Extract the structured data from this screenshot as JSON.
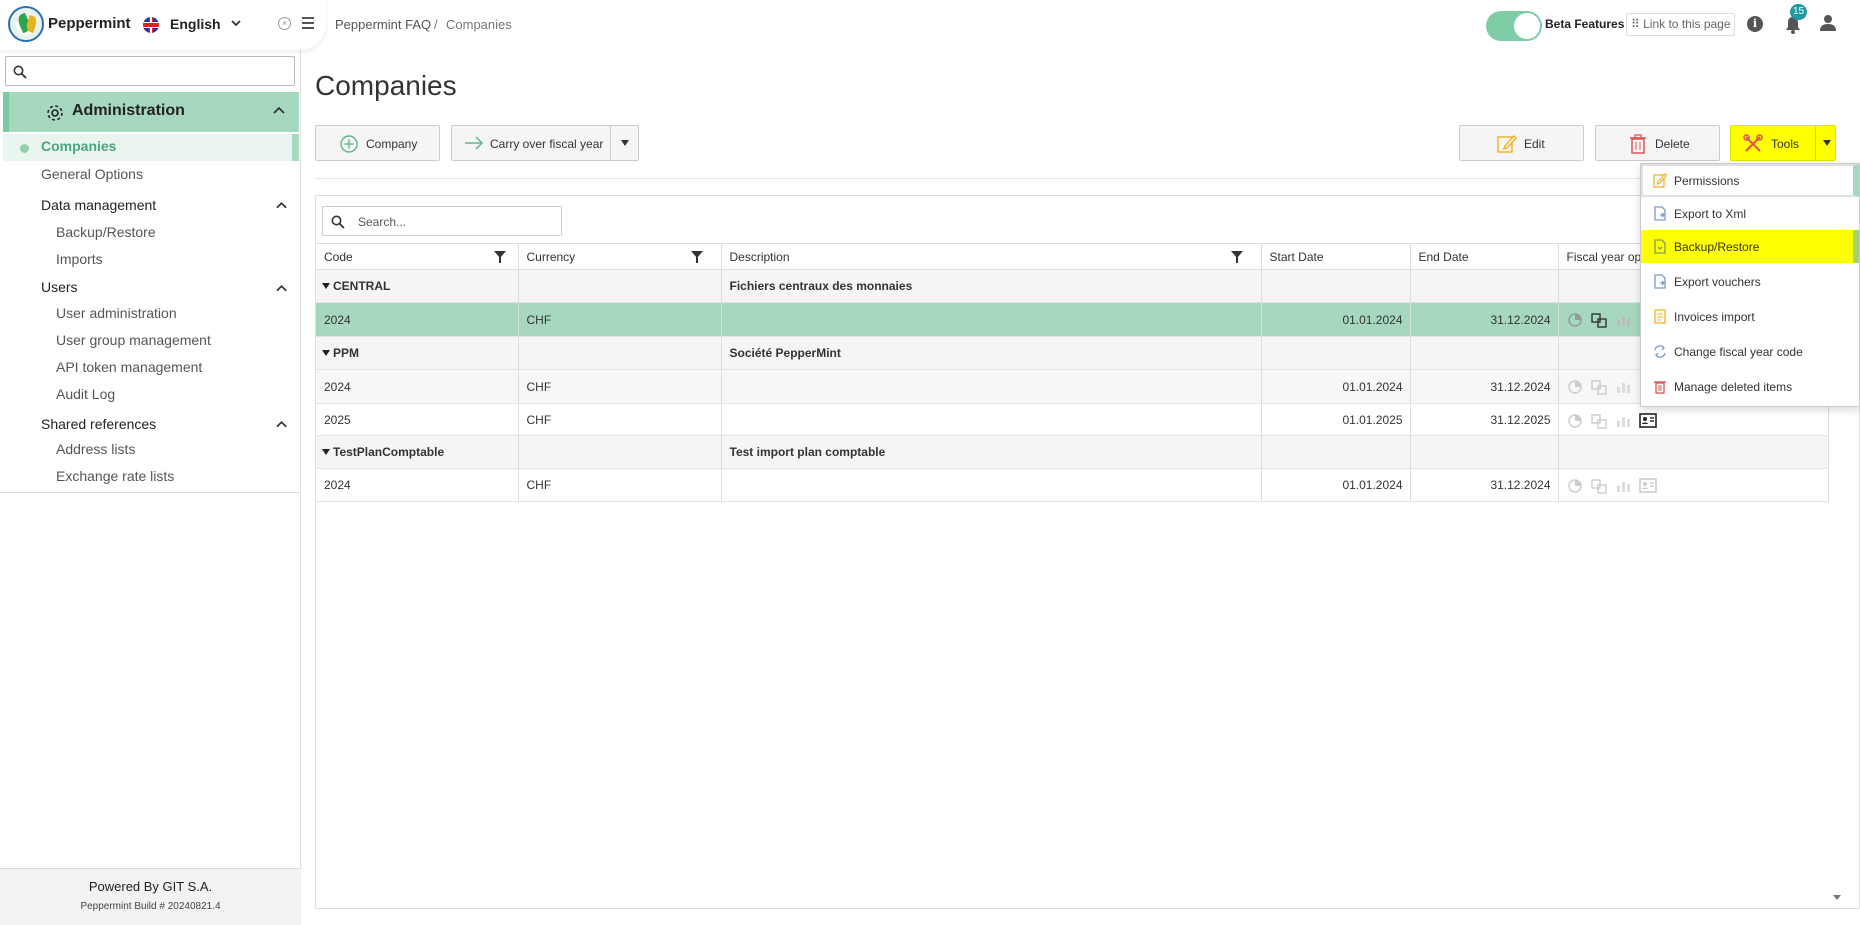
{
  "app": {
    "name": "Peppermint",
    "language": "English"
  },
  "breadcrumb": {
    "root": "Peppermint FAQ",
    "separator": "/",
    "current": "Companies"
  },
  "topbar": {
    "beta_label": "Beta Features",
    "link_label": "⠿ Link to this page",
    "notification_count": "15",
    "info_glyph": "i"
  },
  "sidebar": {
    "section": "Administration",
    "active_item": "Companies",
    "items": [
      {
        "label": "General Options"
      }
    ],
    "groups": [
      {
        "label": "Data management",
        "items": [
          "Backup/Restore",
          "Imports"
        ]
      },
      {
        "label": "Users",
        "items": [
          "User administration",
          "User group management",
          "API token management",
          "Audit Log"
        ]
      },
      {
        "label": "Shared references",
        "items": [
          "Address lists",
          "Exchange rate lists"
        ]
      }
    ],
    "footer": {
      "powered": "Powered By GIT S.A.",
      "build": "Peppermint Build # 20240821.4"
    }
  },
  "main": {
    "title": "Companies",
    "buttons": {
      "company": "Company",
      "carry_over": "Carry over fiscal year",
      "edit": "Edit",
      "delete": "Delete",
      "tools": "Tools"
    },
    "search_placeholder": "Search...",
    "columns": [
      "Code",
      "Currency",
      "Description",
      "Start Date",
      "End Date",
      "Fiscal year op"
    ],
    "groups": [
      {
        "code": "CENTRAL",
        "description": "Fichiers centraux des monnaies",
        "rows": [
          {
            "year": "2024",
            "currency": "CHF",
            "start": "01.01.2024",
            "end": "31.12.2024",
            "selected": true
          }
        ]
      },
      {
        "code": "PPM",
        "description": "Société PepperMint",
        "rows": [
          {
            "year": "2024",
            "currency": "CHF",
            "start": "01.01.2024",
            "end": "31.12.2024"
          },
          {
            "year": "2025",
            "currency": "CHF",
            "start": "01.01.2025",
            "end": "31.12.2025"
          }
        ]
      },
      {
        "code": "TestPlanComptable",
        "description": "Test import plan comptable",
        "rows": [
          {
            "year": "2024",
            "currency": "CHF",
            "start": "01.01.2024",
            "end": "31.12.2024"
          }
        ]
      }
    ]
  },
  "tools_menu": {
    "items": [
      {
        "label": "Permissions",
        "icon": "edit-icon"
      },
      {
        "label": "Export to Xml",
        "icon": "file-export-icon"
      },
      {
        "label": "Backup/Restore",
        "icon": "backup-file-icon",
        "highlighted": true
      },
      {
        "label": "Export vouchers",
        "icon": "file-export-icon"
      },
      {
        "label": "Invoices import",
        "icon": "invoice-icon"
      },
      {
        "label": "Change fiscal year code",
        "icon": "sync-icon"
      },
      {
        "label": "Manage deleted items",
        "icon": "trash-icon"
      }
    ]
  },
  "colors": {
    "accent": "#a6d8c0",
    "accent_text": "#4aa57c",
    "highlight": "#ffff00",
    "badge": "#1f9aa0"
  }
}
